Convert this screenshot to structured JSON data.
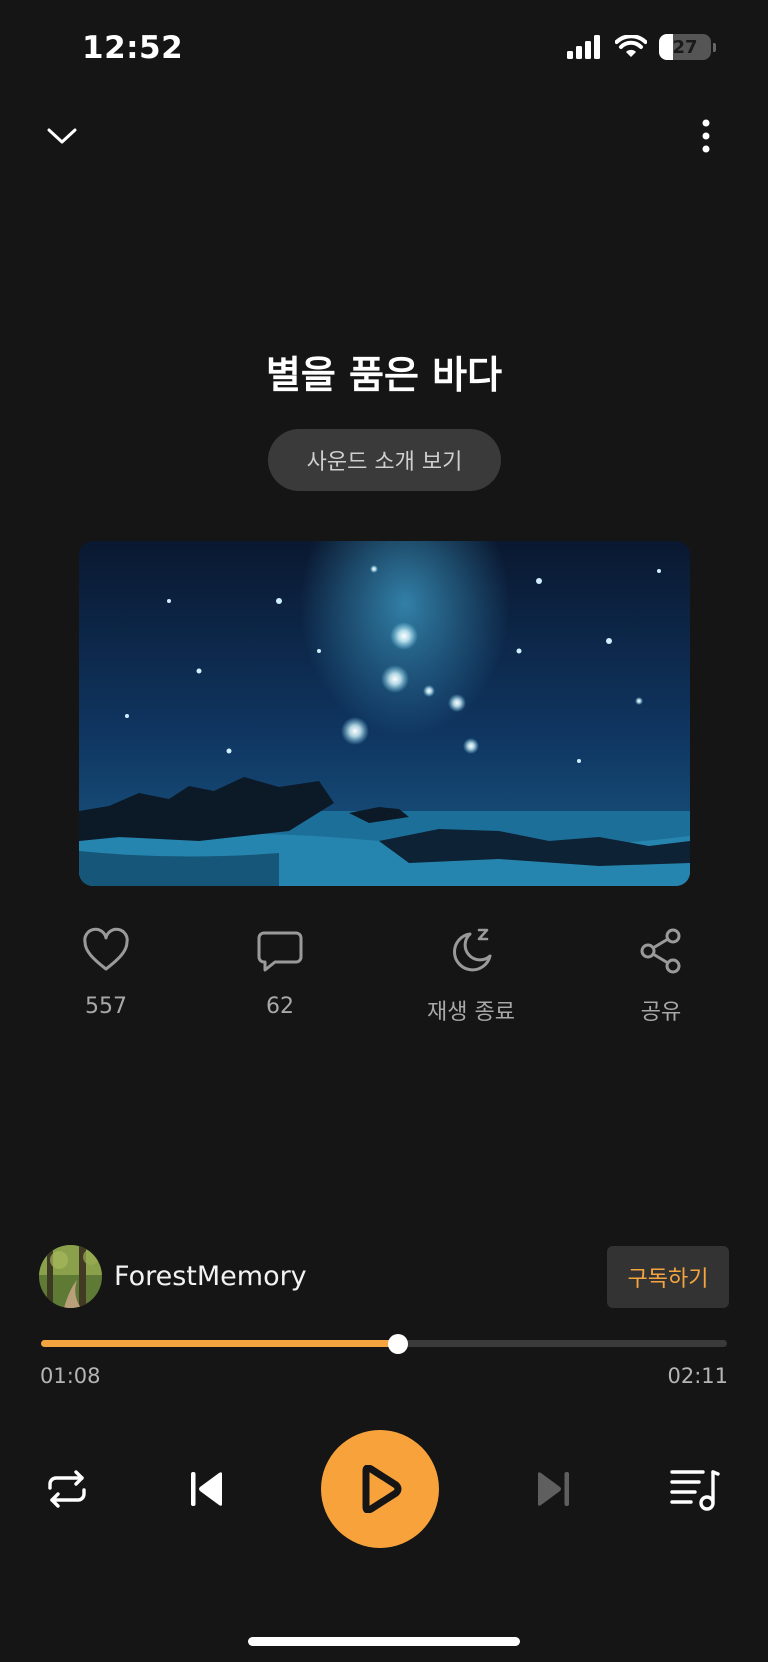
{
  "status_bar": {
    "time": "12:52",
    "battery_percent": "27",
    "battery_level": 0.27
  },
  "track": {
    "title": "별을 품은 바다",
    "intro_button": "사운드 소개 보기"
  },
  "actions": {
    "like": {
      "label": "557",
      "icon": "heart-icon"
    },
    "comment": {
      "label": "62",
      "icon": "comment-icon"
    },
    "sleep_timer": {
      "label": "재생 종료",
      "icon": "moon-sleep-icon"
    },
    "share": {
      "label": "공유",
      "icon": "share-icon"
    }
  },
  "creator": {
    "name": "ForestMemory",
    "subscribe_label": "구독하기"
  },
  "playback": {
    "current_time": "01:08",
    "total_time": "02:11",
    "progress": 0.52
  },
  "controls": [
    "repeat-icon",
    "previous-icon",
    "play-icon",
    "next-icon",
    "playlist-icon"
  ],
  "colors": {
    "accent": "#f7a23a",
    "background": "#151515"
  }
}
